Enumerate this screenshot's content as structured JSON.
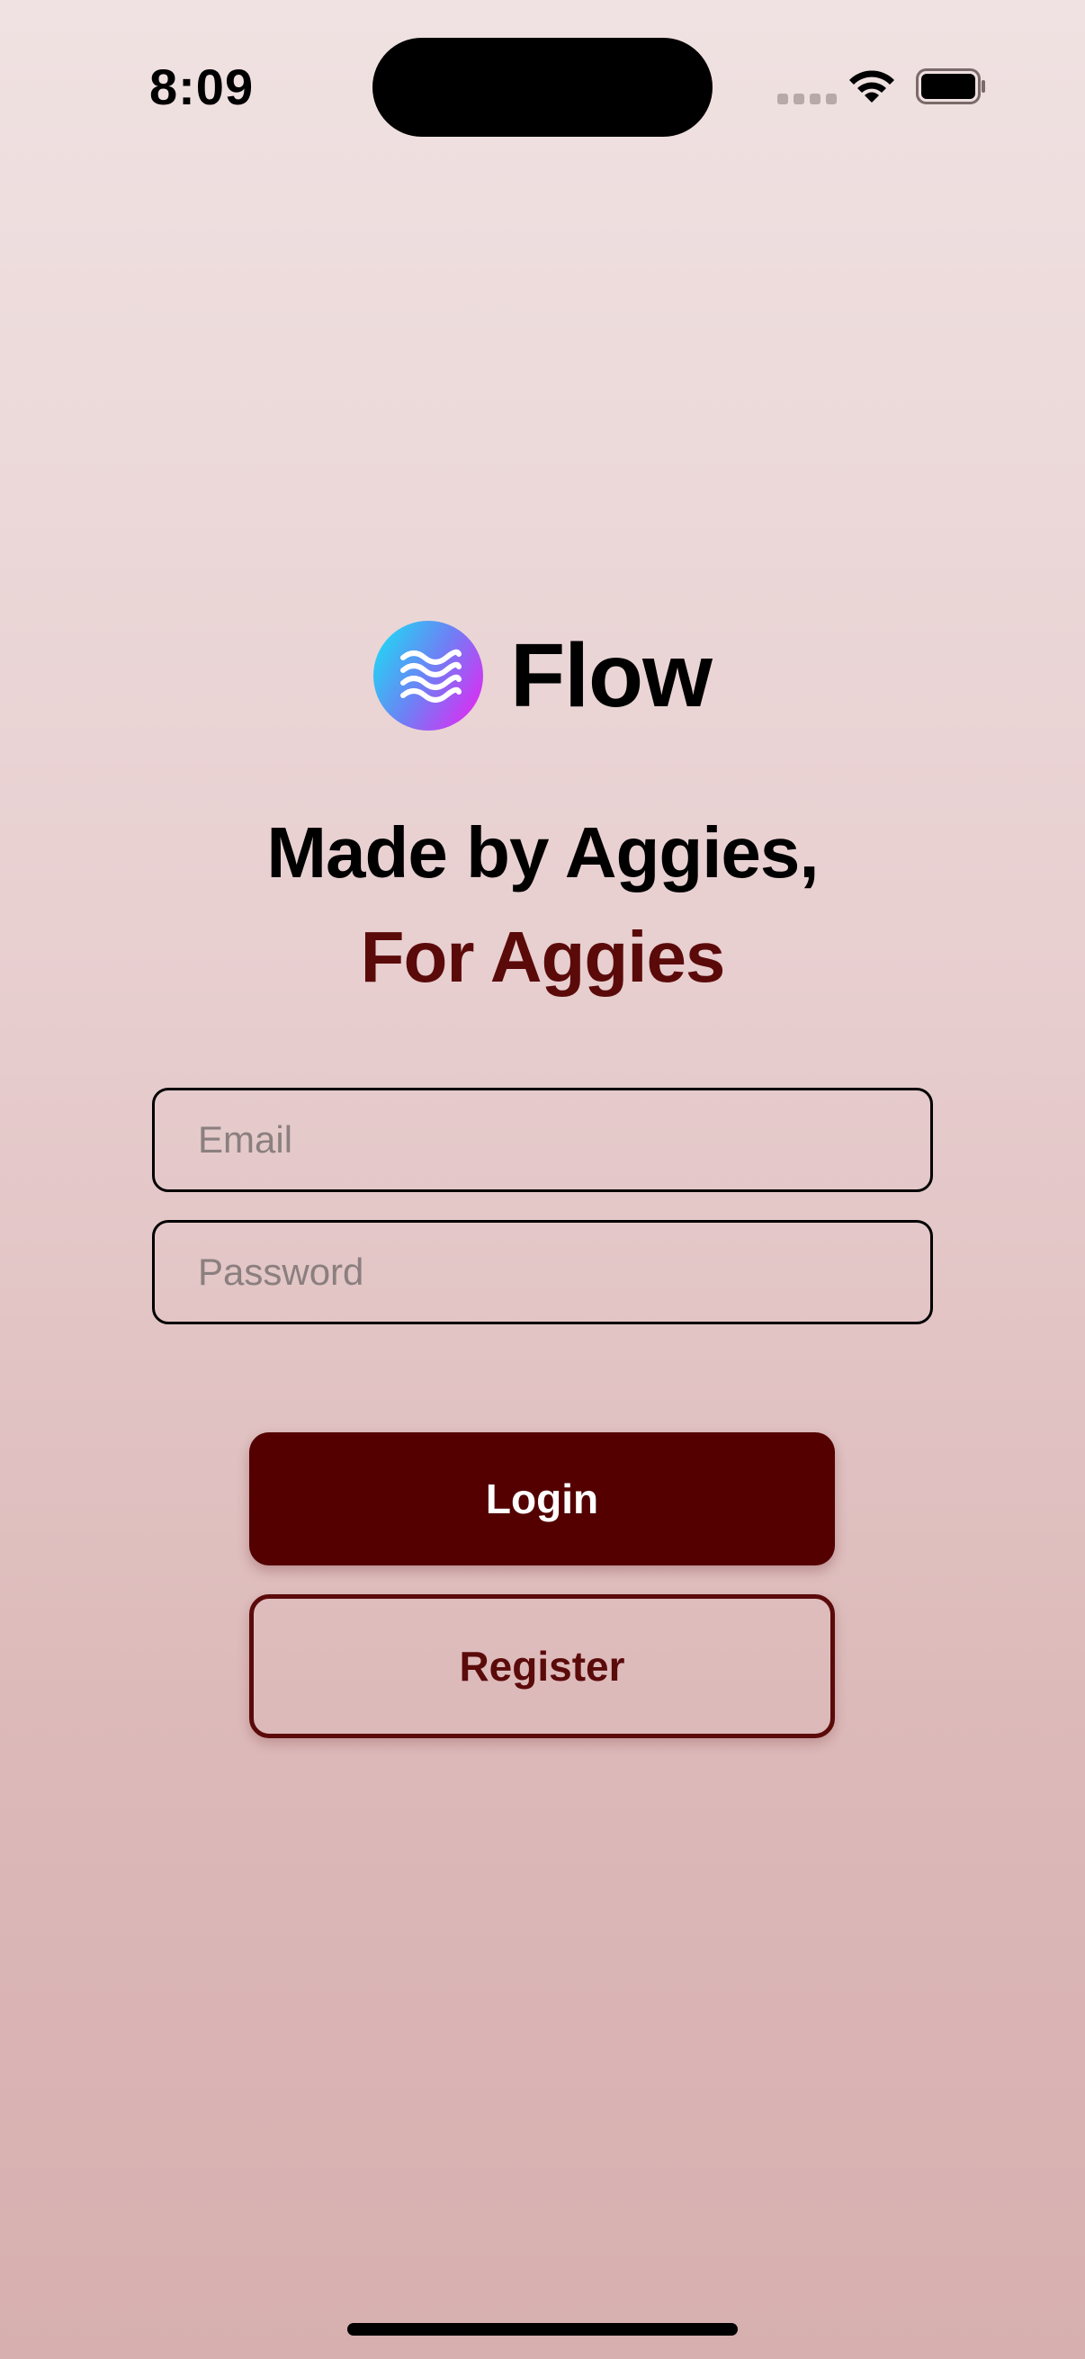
{
  "status_bar": {
    "time": "8:09"
  },
  "brand": {
    "name": "Flow",
    "logo_icon": "waves-icon"
  },
  "tagline": {
    "line1": "Made by Aggies,",
    "line2": "For Aggies"
  },
  "form": {
    "email_placeholder": "Email",
    "email_value": "",
    "password_placeholder": "Password",
    "password_value": ""
  },
  "actions": {
    "login_label": "Login",
    "register_label": "Register"
  },
  "colors": {
    "accent_maroon": "#540000",
    "tagline_maroon": "#5b0a0a",
    "logo_gradient_start": "#13e6f3",
    "logo_gradient_end": "#f21cf2"
  }
}
